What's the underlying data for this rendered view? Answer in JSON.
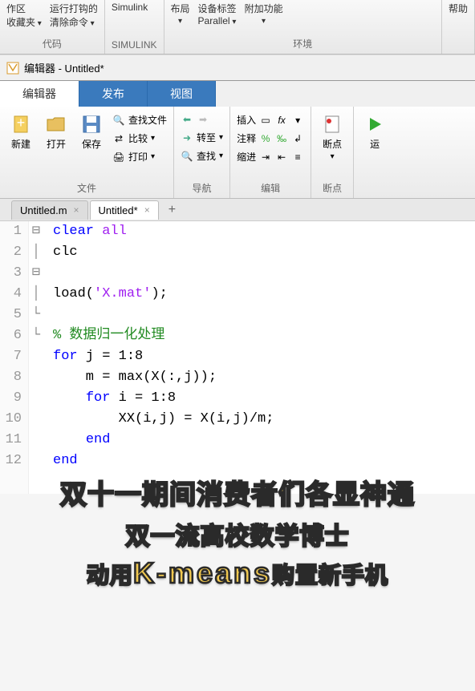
{
  "top_ribbon": {
    "groups": [
      {
        "label": "代码",
        "items_col1": [
          "作区",
          "收藏夹"
        ],
        "items_col2": [
          "运行打钩的",
          "清除命令"
        ]
      },
      {
        "label": "SIMULINK",
        "items": [
          "Simulink"
        ]
      },
      {
        "label": "环境",
        "items": [
          "布局",
          "设备标签",
          "Parallel",
          "附加功能"
        ]
      },
      {
        "label": "",
        "items": [
          "帮助"
        ]
      }
    ]
  },
  "window": {
    "title": "编辑器 - Untitled*"
  },
  "main_tabs": [
    {
      "label": "编辑器",
      "active": true
    },
    {
      "label": "发布",
      "active": false
    },
    {
      "label": "视图",
      "active": false
    }
  ],
  "ribbon": {
    "file": {
      "label": "文件",
      "new": "新建",
      "open": "打开",
      "save": "保存",
      "find_files": "查找文件",
      "compare": "比较",
      "print": "打印"
    },
    "nav": {
      "label": "导航",
      "goto": "转至",
      "find": "查找"
    },
    "edit": {
      "label": "编辑",
      "insert": "插入",
      "comment": "注释",
      "indent": "缩进"
    },
    "breakpoint": {
      "label": "断点",
      "breakpoint": "断点"
    },
    "run": {
      "label": "",
      "run": "运"
    }
  },
  "file_tabs": [
    {
      "name": "Untitled.m",
      "active": false
    },
    {
      "name": "Untitled*",
      "active": true
    }
  ],
  "code": {
    "lines": [
      {
        "n": 1,
        "fold": "",
        "tokens": [
          {
            "t": "kw",
            "v": "clear "
          },
          {
            "t": "str",
            "v": "all"
          }
        ]
      },
      {
        "n": 2,
        "fold": "",
        "tokens": [
          {
            "t": "",
            "v": "clc"
          }
        ]
      },
      {
        "n": 3,
        "fold": "",
        "tokens": []
      },
      {
        "n": 4,
        "fold": "",
        "tokens": [
          {
            "t": "",
            "v": "load("
          },
          {
            "t": "str",
            "v": "'X.mat'"
          },
          {
            "t": "",
            "v": ");"
          }
        ]
      },
      {
        "n": 5,
        "fold": "",
        "tokens": []
      },
      {
        "n": 6,
        "fold": "",
        "tokens": [
          {
            "t": "com",
            "v": "% 数据归一化处理"
          }
        ]
      },
      {
        "n": 7,
        "fold": "⊟",
        "tokens": [
          {
            "t": "kw",
            "v": "for"
          },
          {
            "t": "",
            "v": " j = 1:8"
          }
        ]
      },
      {
        "n": 8,
        "fold": "│",
        "tokens": [
          {
            "t": "",
            "v": "    m = max(X(:,j));"
          }
        ]
      },
      {
        "n": 9,
        "fold": "⊟",
        "tokens": [
          {
            "t": "",
            "v": "    "
          },
          {
            "t": "kw",
            "v": "for"
          },
          {
            "t": "",
            "v": " i = 1:8"
          }
        ]
      },
      {
        "n": 10,
        "fold": "│",
        "tokens": [
          {
            "t": "",
            "v": "        XX(i,j) = X(i,j)/m;"
          }
        ]
      },
      {
        "n": 11,
        "fold": "└",
        "tokens": [
          {
            "t": "",
            "v": "    "
          },
          {
            "t": "kw",
            "v": "end"
          }
        ]
      },
      {
        "n": 12,
        "fold": "└",
        "tokens": [
          {
            "t": "kw",
            "v": "end"
          }
        ]
      }
    ]
  },
  "overlay": {
    "line1": "双十一期间消费者们各显神通",
    "line2": "双一流高校数学博士",
    "line3_pre": "动用",
    "line3_kmeans": "K-means",
    "line3_post": "购置新手机"
  }
}
